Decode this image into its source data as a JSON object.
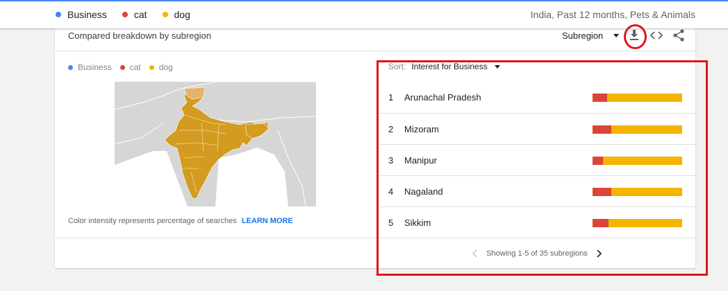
{
  "top_legend": [
    {
      "label": "Business",
      "color": "#4285f4"
    },
    {
      "label": "cat",
      "color": "#db4437"
    },
    {
      "label": "dog",
      "color": "#f4b400"
    }
  ],
  "context": "India, Past 12 months, Pets & Animals",
  "card": {
    "title": "Compared breakdown by subregion",
    "subregion_label": "Subregion",
    "icons": [
      "download-icon",
      "embed-icon",
      "share-icon"
    ]
  },
  "map_legend": [
    {
      "label": "Business",
      "color": "#4285f4"
    },
    {
      "label": "cat",
      "color": "#db4437"
    },
    {
      "label": "dog",
      "color": "#f4b400"
    }
  ],
  "map": {
    "note": "Color intensity represents percentage of searches",
    "learn_more": "LEARN MORE",
    "region_color": "#d39b1f",
    "other_color": "#d6d6d6"
  },
  "sort": {
    "label": "Sort:",
    "value": "Interest for Business"
  },
  "ranking": [
    {
      "rank": "1",
      "name": "Arunachal Pradesh",
      "share": {
        "business": 0,
        "cat": 0.16,
        "dog": 0.84
      }
    },
    {
      "rank": "2",
      "name": "Mizoram",
      "share": {
        "business": 0,
        "cat": 0.21,
        "dog": 0.79
      }
    },
    {
      "rank": "3",
      "name": "Manipur",
      "share": {
        "business": 0,
        "cat": 0.12,
        "dog": 0.88
      }
    },
    {
      "rank": "4",
      "name": "Nagaland",
      "share": {
        "business": 0,
        "cat": 0.21,
        "dog": 0.79
      }
    },
    {
      "rank": "5",
      "name": "Sikkim",
      "share": {
        "business": 0,
        "cat": 0.18,
        "dog": 0.82
      }
    }
  ],
  "pager": {
    "text": "Showing 1-5 of 35 subregions"
  },
  "colors": {
    "business": "#4285f4",
    "cat": "#db4437",
    "dog": "#f4b400",
    "annotation": "#e0141e"
  }
}
